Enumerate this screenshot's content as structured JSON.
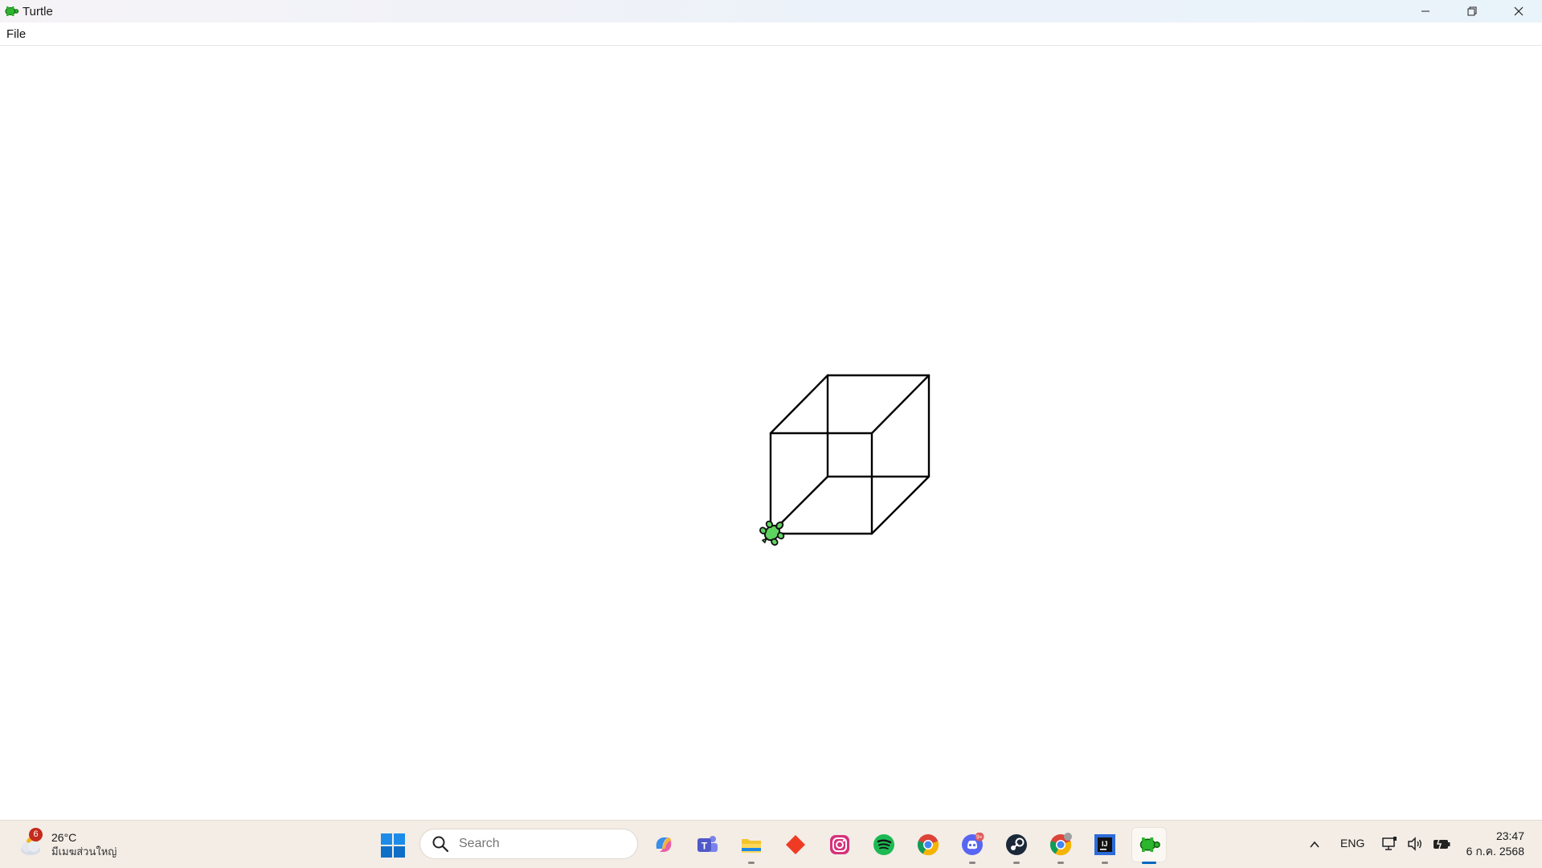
{
  "window": {
    "title": "Turtle",
    "controls": {
      "minimize": "minimize-icon",
      "restore": "restore-icon",
      "close": "close-icon"
    }
  },
  "menu": {
    "items": [
      {
        "label": "File"
      }
    ]
  },
  "canvas": {
    "drawing": "wireframe-cube",
    "turtle_color": "#33cc33",
    "line_color": "#000000"
  },
  "taskbar": {
    "weather": {
      "badge": "6",
      "temperature": "26°C",
      "condition": "มีเมฆส่วนใหญ่"
    },
    "search": {
      "placeholder": "Search"
    },
    "apps": [
      {
        "name": "copilot",
        "icon": "copilot-icon"
      },
      {
        "name": "teams",
        "icon": "teams-icon"
      },
      {
        "name": "file-explorer",
        "icon": "folder-icon"
      },
      {
        "name": "anydesk",
        "icon": "diamond-icon"
      },
      {
        "name": "instagram",
        "icon": "instagram-icon"
      },
      {
        "name": "spotify",
        "icon": "spotify-icon"
      },
      {
        "name": "chrome",
        "icon": "chrome-icon"
      },
      {
        "name": "discord",
        "icon": "discord-icon",
        "badge": "9+"
      },
      {
        "name": "steam",
        "icon": "steam-icon"
      },
      {
        "name": "chrome-profile",
        "icon": "chrome-icon"
      },
      {
        "name": "jetbrains",
        "icon": "jetbrains-icon"
      },
      {
        "name": "turtle",
        "icon": "turtle-icon",
        "active": true
      }
    ],
    "tray": {
      "language": "ENG"
    },
    "clock": {
      "time": "23:47",
      "date": "6 ก.ค. 2568"
    }
  },
  "colors": {
    "accent": "#0067c0",
    "taskbar_bg": "#f3ede6"
  }
}
